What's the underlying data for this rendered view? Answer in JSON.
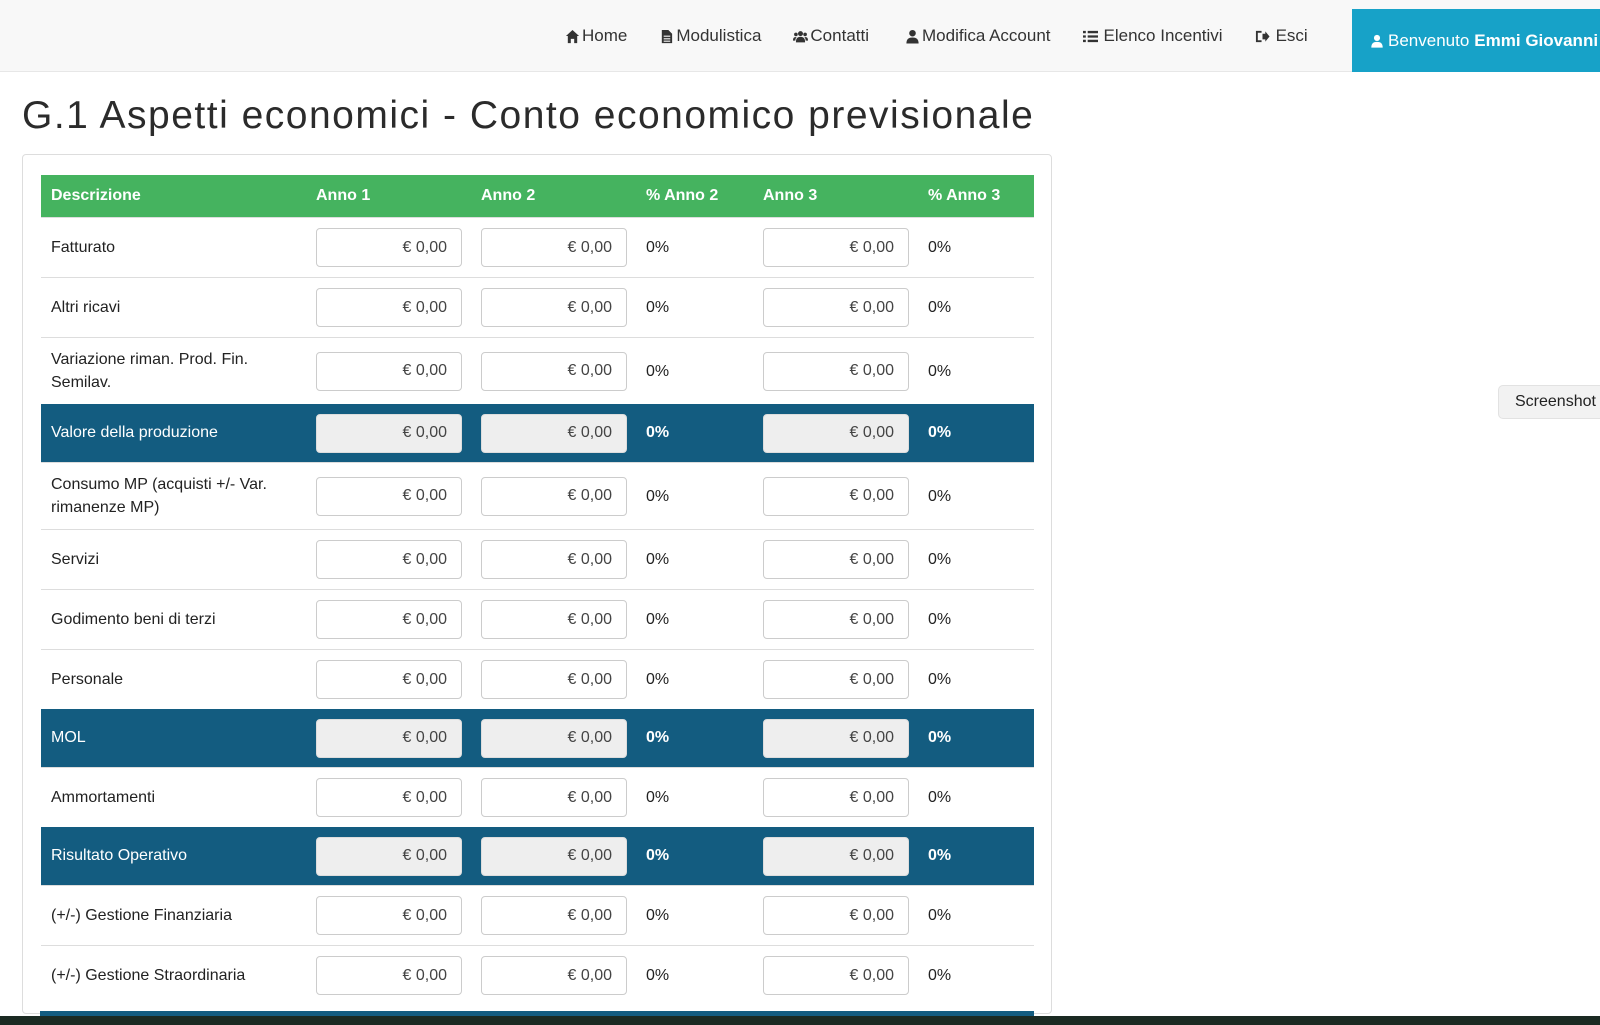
{
  "nav": {
    "items": [
      {
        "label": "Home",
        "icon": "home-icon"
      },
      {
        "label": "Modulistica",
        "icon": "file-icon"
      },
      {
        "label": "Contatti",
        "icon": "users-icon"
      },
      {
        "label": "Modifica Account",
        "icon": "user-icon"
      },
      {
        "label": "Elenco Incentivi",
        "icon": "list-icon"
      },
      {
        "label": "Esci",
        "icon": "sign-out-icon"
      }
    ],
    "welcome_prefix": "Benvenuto",
    "welcome_name": "Emmi Giovanni"
  },
  "page": {
    "title": "G.1 Aspetti economici - Conto economico previsionale"
  },
  "table": {
    "headers": [
      "Descrizione",
      "Anno 1",
      "Anno 2",
      "% Anno 2",
      "Anno 3",
      "% Anno 3"
    ],
    "rows": [
      {
        "label": "Fatturato",
        "a1": "€ 0,00",
        "a2": "€ 0,00",
        "p2": "0%",
        "a3": "€ 0,00",
        "p3": "0%"
      },
      {
        "label": "Altri ricavi",
        "a1": "€ 0,00",
        "a2": "€ 0,00",
        "p2": "0%",
        "a3": "€ 0,00",
        "p3": "0%"
      },
      {
        "label": "Variazione riman. Prod. Fin. Semilav.",
        "a1": "€ 0,00",
        "a2": "€ 0,00",
        "p2": "0%",
        "a3": "€ 0,00",
        "p3": "0%"
      },
      {
        "label": "Valore della produzione",
        "a1": "€ 0,00",
        "a2": "€ 0,00",
        "p2": "0%",
        "a3": "€ 0,00",
        "p3": "0%"
      },
      {
        "label": "Consumo MP (acquisti +/- Var. rimanenze MP)",
        "a1": "€ 0,00",
        "a2": "€ 0,00",
        "p2": "0%",
        "a3": "€ 0,00",
        "p3": "0%"
      },
      {
        "label": "Servizi",
        "a1": "€ 0,00",
        "a2": "€ 0,00",
        "p2": "0%",
        "a3": "€ 0,00",
        "p3": "0%"
      },
      {
        "label": "Godimento beni di terzi",
        "a1": "€ 0,00",
        "a2": "€ 0,00",
        "p2": "0%",
        "a3": "€ 0,00",
        "p3": "0%"
      },
      {
        "label": "Personale",
        "a1": "€ 0,00",
        "a2": "€ 0,00",
        "p2": "0%",
        "a3": "€ 0,00",
        "p3": "0%"
      },
      {
        "label": "MOL",
        "a1": "€ 0,00",
        "a2": "€ 0,00",
        "p2": "0%",
        "a3": "€ 0,00",
        "p3": "0%"
      },
      {
        "label": "Ammortamenti",
        "a1": "€ 0,00",
        "a2": "€ 0,00",
        "p2": "0%",
        "a3": "€ 0,00",
        "p3": "0%"
      },
      {
        "label": "Risultato Operativo",
        "a1": "€ 0,00",
        "a2": "€ 0,00",
        "p2": "0%",
        "a3": "€ 0,00",
        "p3": "0%"
      },
      {
        "label": "(+/-) Gestione Finanziaria",
        "a1": "€ 0,00",
        "a2": "€ 0,00",
        "p2": "0%",
        "a3": "€ 0,00",
        "p3": "0%"
      },
      {
        "label": "(+/-) Gestione Straordinaria",
        "a1": "€ 0,00",
        "a2": "€ 0,00",
        "p2": "0%",
        "a3": "€ 0,00",
        "p3": "0%"
      }
    ]
  },
  "screenshot_tab": {
    "label": "Screenshot"
  },
  "colors": {
    "header_green": "#45b35f",
    "total_row_blue": "#135c80",
    "welcome_cyan": "#17a2c8"
  }
}
